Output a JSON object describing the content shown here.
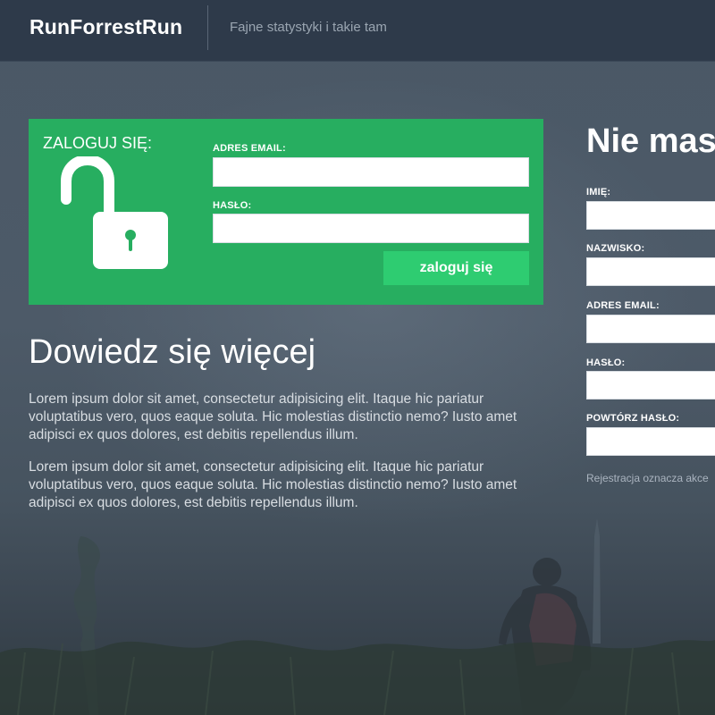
{
  "header": {
    "brand": "RunForrestRun",
    "tagline": "Fajne statystyki i takie tam"
  },
  "login": {
    "title": "ZALOGUJ SIĘ:",
    "email_label": "ADRES EMAIL:",
    "email_value": "",
    "password_label": "HASŁO:",
    "password_value": "",
    "submit_label": "zaloguj się",
    "icon": "unlocked-padlock-icon"
  },
  "learn_more": {
    "title": "Dowiedz się więcej",
    "paragraphs": [
      "Lorem ipsum dolor sit amet, consectetur adipisicing elit. Itaque hic pariatur voluptatibus vero, quos eaque soluta. Hic molestias distinctio nemo? Iusto amet adipisci ex quos dolores, est debitis repellendus illum.",
      "Lorem ipsum dolor sit amet, consectetur adipisicing elit. Itaque hic pariatur voluptatibus vero, quos eaque soluta. Hic molestias distinctio nemo? Iusto amet adipisci ex quos dolores, est debitis repellendus illum."
    ]
  },
  "register": {
    "title": "Nie mas",
    "fields": [
      {
        "label": "IMIĘ:",
        "value": ""
      },
      {
        "label": "NAZWISKO:",
        "value": ""
      },
      {
        "label": "ADRES EMAIL:",
        "value": ""
      },
      {
        "label": "HASŁO:",
        "value": ""
      },
      {
        "label": "POWTÓRZ HASŁO:",
        "value": ""
      }
    ],
    "note": "Rejestracja oznacza akce"
  },
  "colors": {
    "header_bg": "#2e3a4a",
    "login_box": "#27ae60",
    "login_button": "#2ecc71"
  }
}
